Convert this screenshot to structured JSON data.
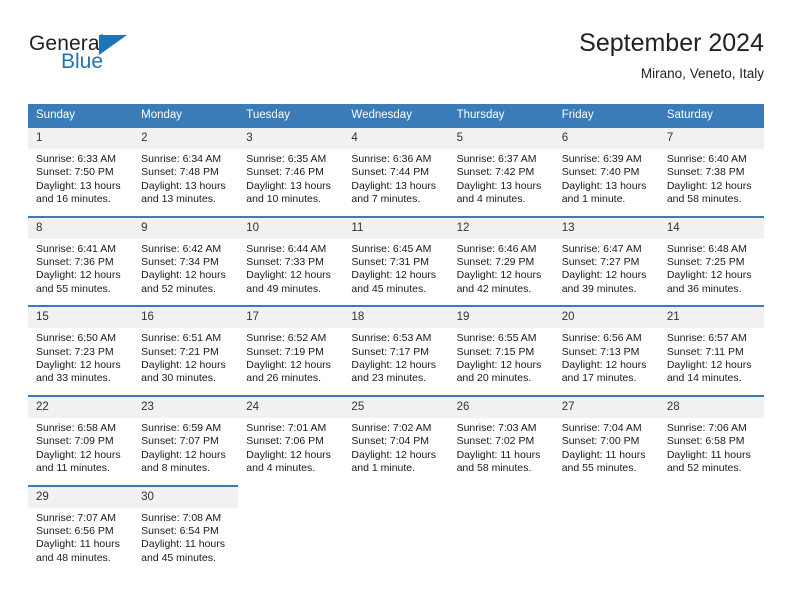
{
  "brand": {
    "name_part1": "General",
    "name_part2": "Blue",
    "logo_icon": "blue-triangle-icon"
  },
  "header": {
    "title": "September 2024",
    "subtitle": "Mirano, Veneto, Italy"
  },
  "colors": {
    "header_blue": "#3a7cb8",
    "brand_blue": "#1b75bb",
    "daynum_bg": "#f1f1f1",
    "text": "#1a1a1a"
  },
  "weekday_headers": [
    "Sunday",
    "Monday",
    "Tuesday",
    "Wednesday",
    "Thursday",
    "Friday",
    "Saturday"
  ],
  "labels": {
    "sunrise_prefix": "Sunrise:",
    "sunset_prefix": "Sunset:",
    "daylight_prefix": "Daylight:"
  },
  "weeks": [
    {
      "days": [
        {
          "num": "1",
          "sunrise": "Sunrise: 6:33 AM",
          "sunset": "Sunset: 7:50 PM",
          "daylight_l1": "Daylight: 13 hours",
          "daylight_l2": "and 16 minutes."
        },
        {
          "num": "2",
          "sunrise": "Sunrise: 6:34 AM",
          "sunset": "Sunset: 7:48 PM",
          "daylight_l1": "Daylight: 13 hours",
          "daylight_l2": "and 13 minutes."
        },
        {
          "num": "3",
          "sunrise": "Sunrise: 6:35 AM",
          "sunset": "Sunset: 7:46 PM",
          "daylight_l1": "Daylight: 13 hours",
          "daylight_l2": "and 10 minutes."
        },
        {
          "num": "4",
          "sunrise": "Sunrise: 6:36 AM",
          "sunset": "Sunset: 7:44 PM",
          "daylight_l1": "Daylight: 13 hours",
          "daylight_l2": "and 7 minutes."
        },
        {
          "num": "5",
          "sunrise": "Sunrise: 6:37 AM",
          "sunset": "Sunset: 7:42 PM",
          "daylight_l1": "Daylight: 13 hours",
          "daylight_l2": "and 4 minutes."
        },
        {
          "num": "6",
          "sunrise": "Sunrise: 6:39 AM",
          "sunset": "Sunset: 7:40 PM",
          "daylight_l1": "Daylight: 13 hours",
          "daylight_l2": "and 1 minute."
        },
        {
          "num": "7",
          "sunrise": "Sunrise: 6:40 AM",
          "sunset": "Sunset: 7:38 PM",
          "daylight_l1": "Daylight: 12 hours",
          "daylight_l2": "and 58 minutes."
        }
      ]
    },
    {
      "days": [
        {
          "num": "8",
          "sunrise": "Sunrise: 6:41 AM",
          "sunset": "Sunset: 7:36 PM",
          "daylight_l1": "Daylight: 12 hours",
          "daylight_l2": "and 55 minutes."
        },
        {
          "num": "9",
          "sunrise": "Sunrise: 6:42 AM",
          "sunset": "Sunset: 7:34 PM",
          "daylight_l1": "Daylight: 12 hours",
          "daylight_l2": "and 52 minutes."
        },
        {
          "num": "10",
          "sunrise": "Sunrise: 6:44 AM",
          "sunset": "Sunset: 7:33 PM",
          "daylight_l1": "Daylight: 12 hours",
          "daylight_l2": "and 49 minutes."
        },
        {
          "num": "11",
          "sunrise": "Sunrise: 6:45 AM",
          "sunset": "Sunset: 7:31 PM",
          "daylight_l1": "Daylight: 12 hours",
          "daylight_l2": "and 45 minutes."
        },
        {
          "num": "12",
          "sunrise": "Sunrise: 6:46 AM",
          "sunset": "Sunset: 7:29 PM",
          "daylight_l1": "Daylight: 12 hours",
          "daylight_l2": "and 42 minutes."
        },
        {
          "num": "13",
          "sunrise": "Sunrise: 6:47 AM",
          "sunset": "Sunset: 7:27 PM",
          "daylight_l1": "Daylight: 12 hours",
          "daylight_l2": "and 39 minutes."
        },
        {
          "num": "14",
          "sunrise": "Sunrise: 6:48 AM",
          "sunset": "Sunset: 7:25 PM",
          "daylight_l1": "Daylight: 12 hours",
          "daylight_l2": "and 36 minutes."
        }
      ]
    },
    {
      "days": [
        {
          "num": "15",
          "sunrise": "Sunrise: 6:50 AM",
          "sunset": "Sunset: 7:23 PM",
          "daylight_l1": "Daylight: 12 hours",
          "daylight_l2": "and 33 minutes."
        },
        {
          "num": "16",
          "sunrise": "Sunrise: 6:51 AM",
          "sunset": "Sunset: 7:21 PM",
          "daylight_l1": "Daylight: 12 hours",
          "daylight_l2": "and 30 minutes."
        },
        {
          "num": "17",
          "sunrise": "Sunrise: 6:52 AM",
          "sunset": "Sunset: 7:19 PM",
          "daylight_l1": "Daylight: 12 hours",
          "daylight_l2": "and 26 minutes."
        },
        {
          "num": "18",
          "sunrise": "Sunrise: 6:53 AM",
          "sunset": "Sunset: 7:17 PM",
          "daylight_l1": "Daylight: 12 hours",
          "daylight_l2": "and 23 minutes."
        },
        {
          "num": "19",
          "sunrise": "Sunrise: 6:55 AM",
          "sunset": "Sunset: 7:15 PM",
          "daylight_l1": "Daylight: 12 hours",
          "daylight_l2": "and 20 minutes."
        },
        {
          "num": "20",
          "sunrise": "Sunrise: 6:56 AM",
          "sunset": "Sunset: 7:13 PM",
          "daylight_l1": "Daylight: 12 hours",
          "daylight_l2": "and 17 minutes."
        },
        {
          "num": "21",
          "sunrise": "Sunrise: 6:57 AM",
          "sunset": "Sunset: 7:11 PM",
          "daylight_l1": "Daylight: 12 hours",
          "daylight_l2": "and 14 minutes."
        }
      ]
    },
    {
      "days": [
        {
          "num": "22",
          "sunrise": "Sunrise: 6:58 AM",
          "sunset": "Sunset: 7:09 PM",
          "daylight_l1": "Daylight: 12 hours",
          "daylight_l2": "and 11 minutes."
        },
        {
          "num": "23",
          "sunrise": "Sunrise: 6:59 AM",
          "sunset": "Sunset: 7:07 PM",
          "daylight_l1": "Daylight: 12 hours",
          "daylight_l2": "and 8 minutes."
        },
        {
          "num": "24",
          "sunrise": "Sunrise: 7:01 AM",
          "sunset": "Sunset: 7:06 PM",
          "daylight_l1": "Daylight: 12 hours",
          "daylight_l2": "and 4 minutes."
        },
        {
          "num": "25",
          "sunrise": "Sunrise: 7:02 AM",
          "sunset": "Sunset: 7:04 PM",
          "daylight_l1": "Daylight: 12 hours",
          "daylight_l2": "and 1 minute."
        },
        {
          "num": "26",
          "sunrise": "Sunrise: 7:03 AM",
          "sunset": "Sunset: 7:02 PM",
          "daylight_l1": "Daylight: 11 hours",
          "daylight_l2": "and 58 minutes."
        },
        {
          "num": "27",
          "sunrise": "Sunrise: 7:04 AM",
          "sunset": "Sunset: 7:00 PM",
          "daylight_l1": "Daylight: 11 hours",
          "daylight_l2": "and 55 minutes."
        },
        {
          "num": "28",
          "sunrise": "Sunrise: 7:06 AM",
          "sunset": "Sunset: 6:58 PM",
          "daylight_l1": "Daylight: 11 hours",
          "daylight_l2": "and 52 minutes."
        }
      ]
    },
    {
      "days": [
        {
          "num": "29",
          "sunrise": "Sunrise: 7:07 AM",
          "sunset": "Sunset: 6:56 PM",
          "daylight_l1": "Daylight: 11 hours",
          "daylight_l2": "and 48 minutes."
        },
        {
          "num": "30",
          "sunrise": "Sunrise: 7:08 AM",
          "sunset": "Sunset: 6:54 PM",
          "daylight_l1": "Daylight: 11 hours",
          "daylight_l2": "and 45 minutes."
        },
        {
          "num": "",
          "sunrise": "",
          "sunset": "",
          "daylight_l1": "",
          "daylight_l2": ""
        },
        {
          "num": "",
          "sunrise": "",
          "sunset": "",
          "daylight_l1": "",
          "daylight_l2": ""
        },
        {
          "num": "",
          "sunrise": "",
          "sunset": "",
          "daylight_l1": "",
          "daylight_l2": ""
        },
        {
          "num": "",
          "sunrise": "",
          "sunset": "",
          "daylight_l1": "",
          "daylight_l2": ""
        },
        {
          "num": "",
          "sunrise": "",
          "sunset": "",
          "daylight_l1": "",
          "daylight_l2": ""
        }
      ]
    }
  ]
}
